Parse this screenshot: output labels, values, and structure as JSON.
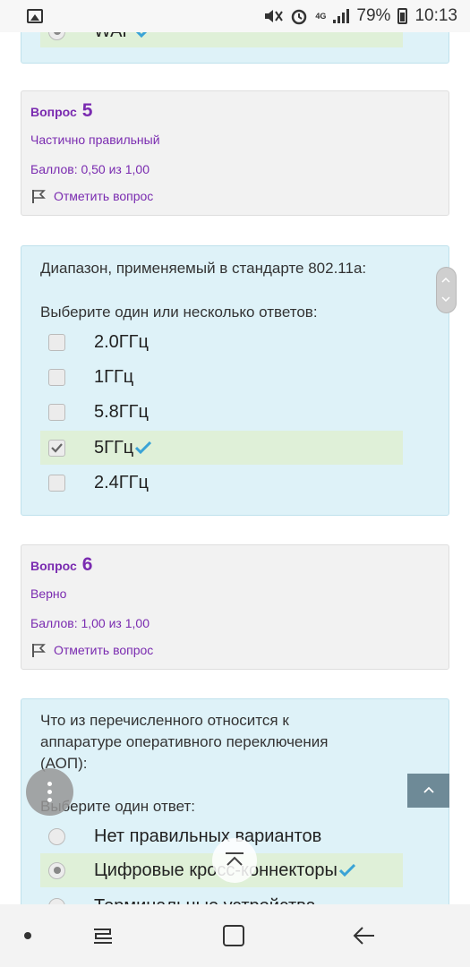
{
  "status_bar": {
    "battery": "79%",
    "time": "10:13",
    "network": "4G"
  },
  "prev_question": {
    "selected_label": "WAP"
  },
  "q5_info": {
    "label": "Вопрос",
    "number": "5",
    "state": "Частично правильный",
    "points": "Баллов: 0,50 из 1,00",
    "flag": "Отметить вопрос"
  },
  "q5": {
    "text": "Диапазон, применяемый в стандарте 802.11a:",
    "prompt": "Выберите один или несколько ответов:",
    "options": [
      "2.0ГГц",
      "1ГГц",
      "5.8ГГц",
      "5ГГц",
      "2.4ГГц"
    ]
  },
  "q6_info": {
    "label": "Вопрос",
    "number": "6",
    "state": "Верно",
    "points": "Баллов: 1,00 из 1,00",
    "flag": "Отметить вопрос"
  },
  "q6": {
    "text_line1": "Что из перечисленного относится к",
    "text_line2": "аппаратуре оперативного переключения",
    "text_line3": "(АОП):",
    "prompt": "Выберите один ответ:",
    "options": [
      "Нет правильных вариантов",
      "Цифровые кросс-коннекторы",
      "Терминальные устройства"
    ]
  },
  "colors": {
    "accent_purple": "#7a2bb0",
    "question_bg": "#def2f8",
    "correct_bg": "#dff0d8",
    "tick": "#3aa3d6"
  }
}
